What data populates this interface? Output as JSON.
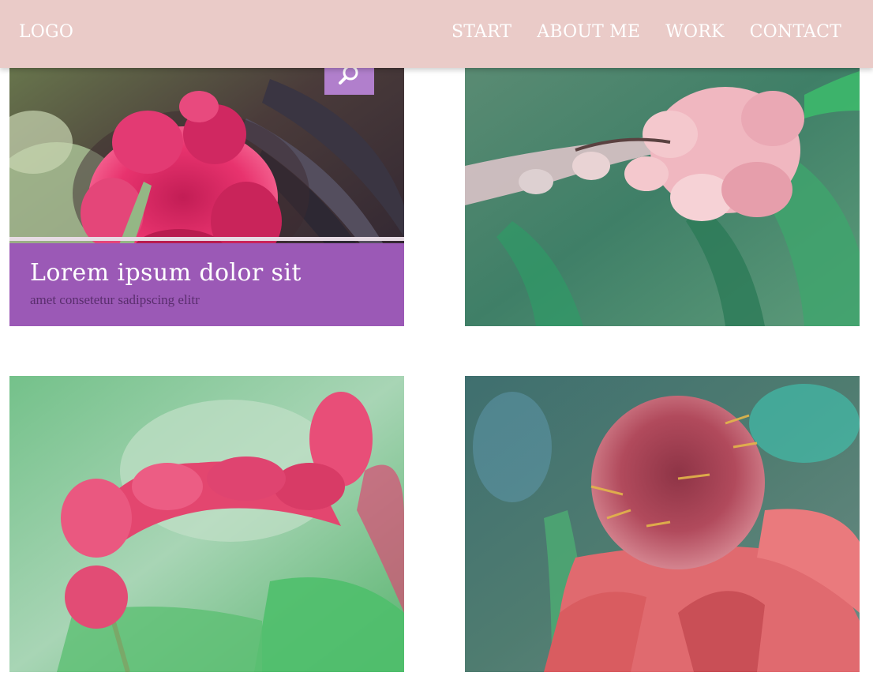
{
  "header": {
    "logo": "LOGO",
    "nav": [
      "START",
      "ABOUT ME",
      "WORK",
      "CONTACT"
    ]
  },
  "gallery": {
    "featured": {
      "title": "Lorem ipsum dolor sit",
      "subtitle": "amet consetetur sadipscing elitr"
    },
    "items": [
      {
        "image": "red-ginger-flower-photo"
      },
      {
        "image": "pink-ginger-flower-photo"
      },
      {
        "image": "red-ginger-stem-photo"
      },
      {
        "image": "torch-ginger-photo"
      }
    ]
  },
  "icons": {
    "search": "search-icon"
  },
  "colors": {
    "header_bg": "#eacbc8",
    "caption_bg": "#9b59b6",
    "search_bg": "#b17fcc",
    "nav_text": "#ffffff"
  }
}
